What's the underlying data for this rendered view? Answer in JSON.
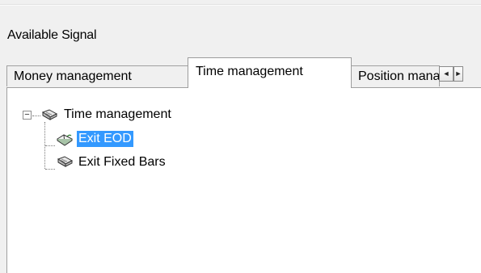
{
  "section_label": "Available Signal",
  "tabs": [
    {
      "label": "Money management",
      "active": false
    },
    {
      "label": "Time management",
      "active": true
    },
    {
      "label": "Position management",
      "active": false
    }
  ],
  "tab_scroll": {
    "left_icon": "◄",
    "right_icon": "►"
  },
  "tree": {
    "root": {
      "label": "Time management",
      "expander": "−",
      "expanded": true,
      "icon": "book-icon"
    },
    "children": [
      {
        "label": "Exit EOD",
        "selected": true,
        "icon": "open-book-icon"
      },
      {
        "label": "Exit Fixed Bars",
        "selected": false,
        "icon": "book-icon"
      }
    ]
  },
  "colors": {
    "selection": "#3399ff",
    "background": "#f0f0f0",
    "panel": "#ffffff"
  }
}
